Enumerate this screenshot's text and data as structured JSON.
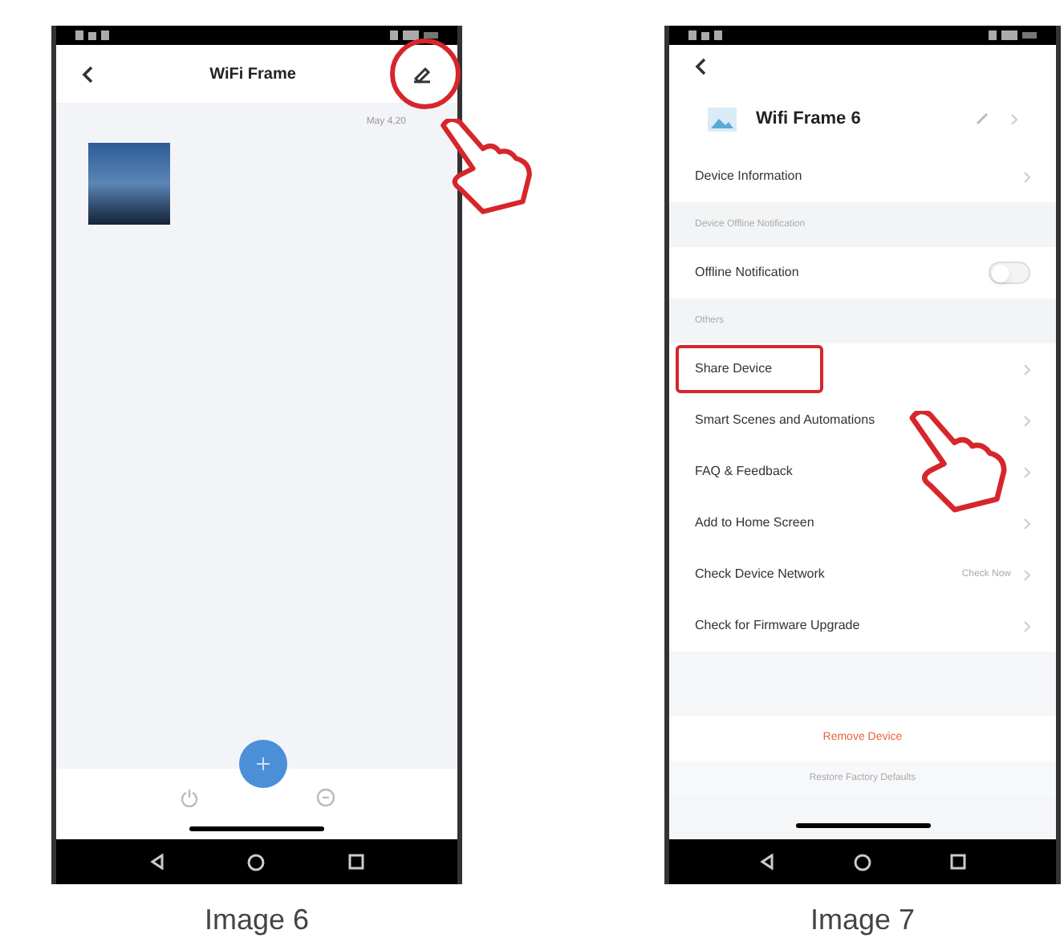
{
  "panels": [
    {
      "caption": "Image 6",
      "screen": {
        "kind": "home",
        "title": "WiFi Frame",
        "date": "May 4,20",
        "edit_marked": true
      }
    },
    {
      "caption": "Image 7",
      "screen": {
        "kind": "settings",
        "title": "Wifi Frame 6",
        "rows": [
          {
            "kind": "link",
            "label": "Device Information",
            "marked": false
          },
          {
            "kind": "section",
            "label": "Device Offline Notification"
          },
          {
            "kind": "toggle",
            "label": "Offline Notification",
            "on": false
          },
          {
            "kind": "section",
            "label": "Others"
          },
          {
            "kind": "link",
            "label": "Share Device",
            "marked": true
          },
          {
            "kind": "link",
            "label": "Smart Scenes and Automations",
            "marked": false
          },
          {
            "kind": "link",
            "label": "FAQ & Feedback",
            "marked": false
          },
          {
            "kind": "link",
            "label": "Add to Home Screen",
            "marked": false
          },
          {
            "kind": "link",
            "label": "Check Device Network",
            "value": "Check Now",
            "marked": false
          },
          {
            "kind": "link",
            "label": "Check for Firmware Upgrade",
            "marked": false
          }
        ],
        "remove": "Remove Device",
        "restore": "Restore Factory Defaults"
      }
    }
  ]
}
